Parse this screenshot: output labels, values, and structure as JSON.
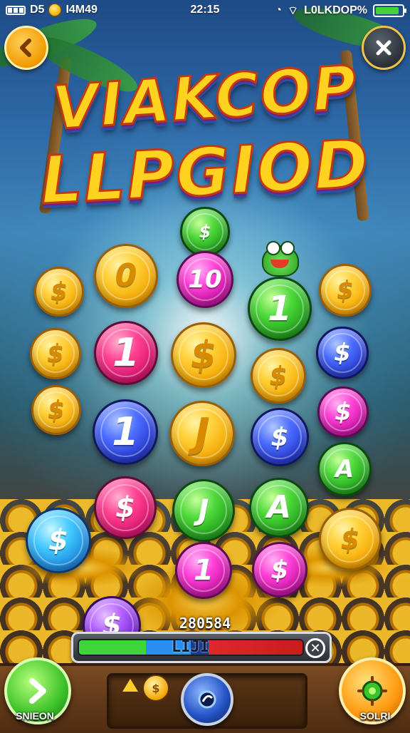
{
  "status_bar": {
    "left_text": "D5",
    "left_text2": "I4M49",
    "time": "22:15",
    "right_text": "L0LKDOP%"
  },
  "title": {
    "line1": "VIAKCOP",
    "line2": "LLPGIOD"
  },
  "coins": [
    {
      "label": "$",
      "color": "green"
    },
    {
      "label": "0",
      "color": "gold"
    },
    {
      "label": "10",
      "color": "magenta"
    },
    {
      "label": "1",
      "color": "green"
    },
    {
      "label": "$",
      "color": "gold"
    },
    {
      "label": "$",
      "color": "gold"
    },
    {
      "label": "1",
      "color": "pink"
    },
    {
      "label": "$",
      "color": "gold"
    },
    {
      "label": "$",
      "color": "gold"
    },
    {
      "label": "$",
      "color": "blue"
    },
    {
      "label": "$",
      "color": "gold"
    },
    {
      "label": "1",
      "color": "blue"
    },
    {
      "label": "J",
      "color": "gold"
    },
    {
      "label": "$",
      "color": "blue"
    },
    {
      "label": "$",
      "color": "magenta"
    },
    {
      "label": "A",
      "color": "green"
    },
    {
      "label": "$",
      "color": "pink"
    },
    {
      "label": "J",
      "color": "green"
    },
    {
      "label": "A",
      "color": "green"
    },
    {
      "label": "$",
      "color": "gold"
    },
    {
      "label": "$",
      "color": "cyan"
    },
    {
      "label": "1",
      "color": "magenta"
    },
    {
      "label": "$",
      "color": "magenta"
    },
    {
      "label": "$",
      "color": "gold"
    },
    {
      "label": "$",
      "color": "purple"
    }
  ],
  "progress": {
    "score": "280584",
    "label": "LIJI",
    "close_icon": "close-icon"
  },
  "bottom_bar": {
    "left_button_label": "SNIEON",
    "right_button_label": "SOLRI",
    "tray_coin_symbol": "$"
  }
}
